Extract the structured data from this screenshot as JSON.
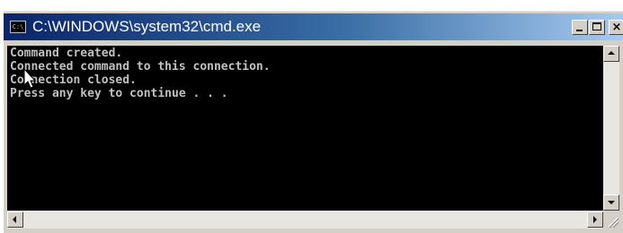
{
  "window": {
    "title": "C:\\WINDOWS\\system32\\cmd.exe",
    "icon": "cmd-icon",
    "icon_text": "C:\\"
  },
  "console": {
    "lines": [
      "Command created.",
      "Connected command to this connection.",
      "Connection closed.",
      "Press any key to continue . . ."
    ]
  },
  "colors": {
    "titlebar_start": "#0a246a",
    "titlebar_end": "#a6caf0",
    "console_bg": "#000000",
    "console_text": "#c0c0c0"
  }
}
